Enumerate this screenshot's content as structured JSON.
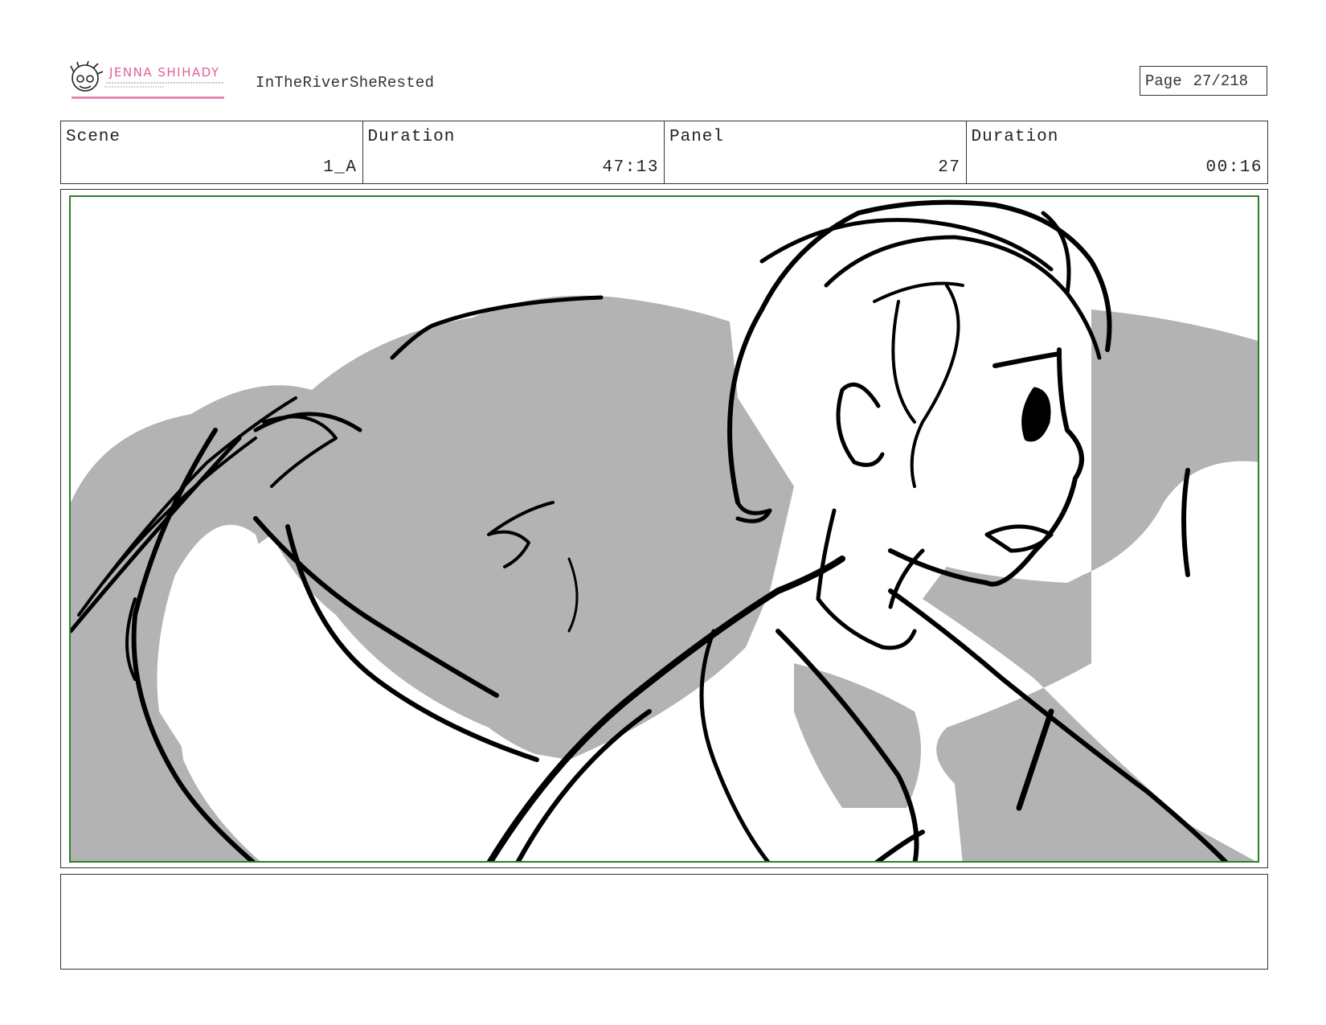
{
  "header": {
    "logo_text": "JENNA SHIHADY",
    "logo_icon": "character-face-icon",
    "project_title": "InTheRiverSheRested",
    "page_label": "Page",
    "page_number": "27/218"
  },
  "info_bar": {
    "scene_label": "Scene",
    "scene_value": "1_A",
    "scene_duration_label": "Duration",
    "scene_duration_value": "47:13",
    "panel_label": "Panel",
    "panel_value": "27",
    "panel_duration_label": "Duration",
    "panel_duration_value": "00:16"
  },
  "panel": {
    "frame_guide_color": "#2f7d2f",
    "tone_color": "#b3b3b3",
    "line_color": "#000000"
  },
  "notes": {
    "text": ""
  }
}
